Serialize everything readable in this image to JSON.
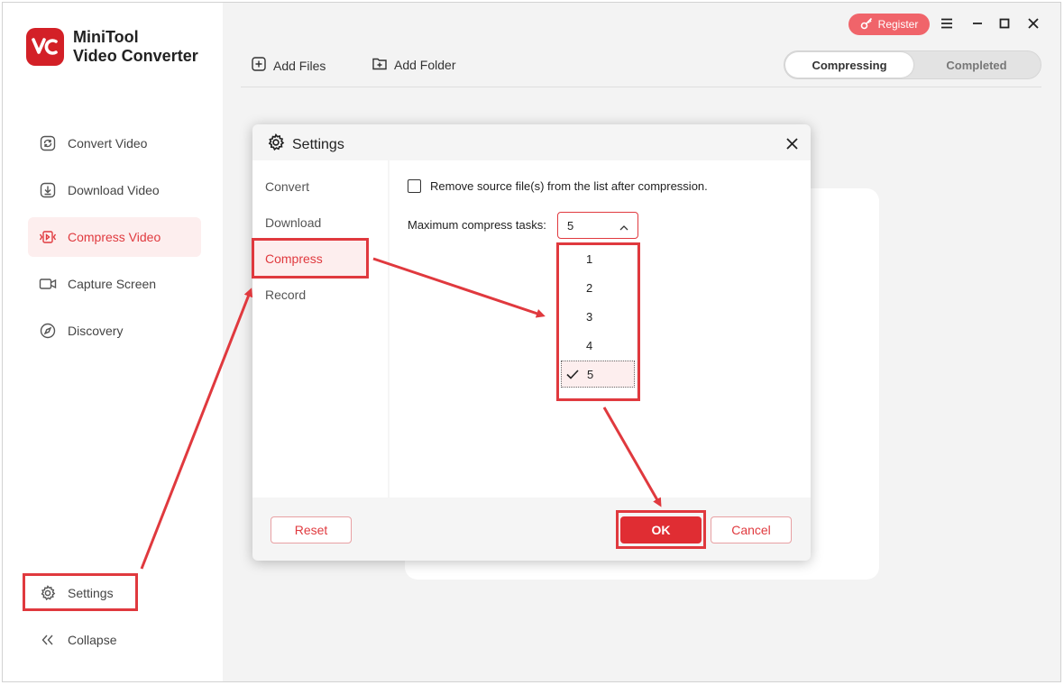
{
  "app": {
    "name_line1": "MiniTool",
    "name_line2": "Video Converter",
    "accent_color": "#e03a3f"
  },
  "sidebar": {
    "items": [
      {
        "label": "Convert Video",
        "icon": "convert-icon",
        "active": false
      },
      {
        "label": "Download Video",
        "icon": "download-icon",
        "active": false
      },
      {
        "label": "Compress Video",
        "icon": "compress-icon",
        "active": true
      },
      {
        "label": "Capture Screen",
        "icon": "camera-icon",
        "active": false
      },
      {
        "label": "Discovery",
        "icon": "compass-icon",
        "active": false
      }
    ],
    "settings_label": "Settings",
    "collapse_label": "Collapse"
  },
  "titlebar": {
    "register_label": "Register"
  },
  "toolbar": {
    "add_files_label": "Add Files",
    "add_folder_label": "Add Folder",
    "tabs": [
      {
        "label": "Compressing",
        "active": true
      },
      {
        "label": "Completed",
        "active": false
      }
    ]
  },
  "settings_dialog": {
    "title": "Settings",
    "menu": [
      {
        "label": "Convert",
        "active": false
      },
      {
        "label": "Download",
        "active": false
      },
      {
        "label": "Compress",
        "active": true
      },
      {
        "label": "Record",
        "active": false
      }
    ],
    "remove_source_label": "Remove source file(s) from the list after compression.",
    "remove_source_checked": false,
    "max_tasks_label": "Maximum compress tasks:",
    "max_tasks_value": "5",
    "max_tasks_options": [
      "1",
      "2",
      "3",
      "4",
      "5"
    ],
    "reset_label": "Reset",
    "ok_label": "OK",
    "cancel_label": "Cancel"
  }
}
